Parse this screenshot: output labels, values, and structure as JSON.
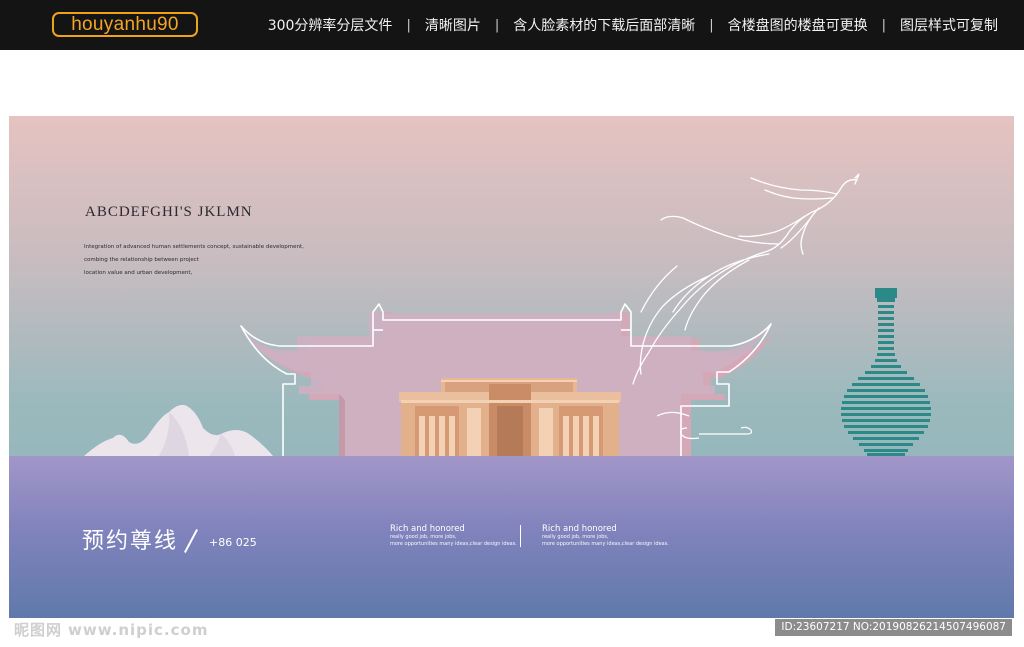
{
  "header": {
    "brand": "houyanhu90",
    "features": [
      "300分辨率分层文件",
      "清晰图片",
      "含人脸素材的下载后面部清晰",
      "含楼盘图的楼盘可更换",
      "图层样式可复制"
    ],
    "separator": "|"
  },
  "poster": {
    "headline": "ABCDEFGHI'S  JKLMN",
    "description": [
      "Integration of advanced human settlements concept, sustainable development,",
      " combing the relationship between project",
      "location value and urban development,"
    ],
    "phone_cn": "预约尊线",
    "phone_num": "+86 025",
    "info_blocks": [
      {
        "title": "Rich and honored",
        "lines": [
          "really good job, more jobs,",
          "more opportunities many ideas,clear design ideas."
        ]
      },
      {
        "title": "Rich and honored",
        "lines": [
          "really good job, more jobs,",
          "more opportunities many ideas,clear design ideas."
        ]
      }
    ]
  },
  "watermark": {
    "logo": "昵图网",
    "url": "www.nipic.com",
    "id_text": "ID:23607217 NO:20190826214507496087"
  },
  "colors": {
    "brand_orange": "#f3a523",
    "topbar_bg": "#141414",
    "sky_top": "#e5c3c0",
    "sky_bottom": "#86b3b7",
    "ground_top": "#a296c8",
    "ground_bottom": "#5f79aa",
    "vase_teal": "#2b8a88"
  }
}
